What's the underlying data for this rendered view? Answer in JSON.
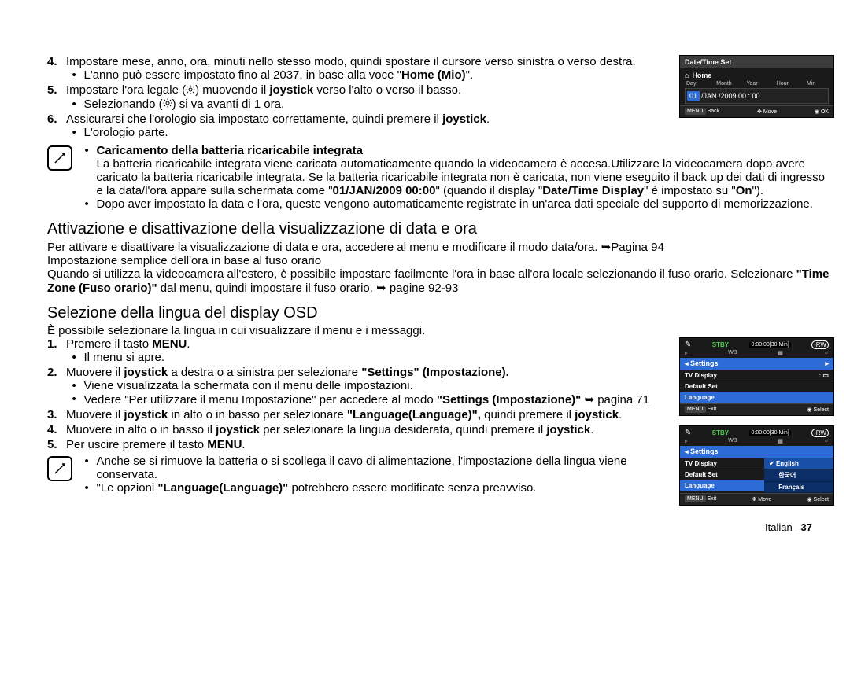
{
  "steps": {
    "s4": {
      "text": "Impostare mese, anno, ora, minuti nello stesso modo, quindi spostare il cursore verso sinistra o verso destra.",
      "sub": "L'anno può essere impostato fino al 2037, in base alla voce \"",
      "sub_bold": "Home (Mio)",
      "sub_end": "\"."
    },
    "s5": {
      "pre": "Impostare l'ora legale (",
      "mid": ") muovendo il ",
      "joystick": "joystick",
      "post": " verso l'alto o verso il basso.",
      "sub_pre": "Selezionando (",
      "sub_post": ") si va avanti di 1 ora."
    },
    "s6": {
      "text": "Assicurarsi che l'orologio sia impostato correttamente, quindi premere il ",
      "joystick": "joystick",
      "end": ".",
      "sub": "L'orologio parte."
    }
  },
  "note1": {
    "title": "Caricamento della batteria ricaricabile integrata",
    "body1": "La batteria ricaricabile integrata viene caricata automaticamente quando la videocamera è accesa.Utilizzare la videocamera dopo avere caricato la batteria ricaricabile integrata. Se la batteria ricaricabile integrata non è caricata, non viene eseguito il back up dei dati di ingresso e la data/l'ora appare sulla schermata come \"",
    "bold1": "01/JAN/2009 00:00",
    "body2": "\" (quando il display \"",
    "bold2": "Date/Time Display",
    "body3": "\" è impostato su \"",
    "bold3": "On",
    "body4": "\").",
    "bullet2": "Dopo aver impostato la data e l'ora, queste vengono automaticamente registrate in un'area dati speciale del supporto di memorizzazione."
  },
  "section1": {
    "heading": "Attivazione e disattivazione della visualizzazione di data e ora",
    "p1": "Per attivare e disattivare la visualizzazione di data e ora, accedere al menu e modificare il modo data/ora.  ➥Pagina 94",
    "p2": "Impostazione semplice dell'ora in base al fuso orario",
    "p3_pre": "Quando si utilizza la videocamera all'estero, è possibile impostare facilmente l'ora in base all'ora locale selezionando il fuso orario. Selezionare ",
    "p3_bold": "\"Time Zone (Fuso orario)\"",
    "p3_post": " dal menu, quindi impostare il fuso orario.  ➥ pagine 92-93"
  },
  "section2": {
    "heading": "Selezione della lingua del display OSD",
    "intro": "È possibile selezionare la lingua in cui visualizzare il menu e i messaggi.",
    "li1_pre": "Premere il tasto ",
    "li1_bold": "MENU",
    "li1_post": ".",
    "li1_sub": "Il menu si apre.",
    "li2_pre": "Muovere il ",
    "li2_joy": "joystick",
    "li2_mid": " a destra o a sinistra per selezionare ",
    "li2_bold": "\"Settings\" (Impostazione).",
    "li2_sub1": "Viene visualizzata la schermata con il menu delle impostazioni.",
    "li2_sub2_pre": "Vedere \"Per utilizzare il menu Impostazione\" per accedere al modo ",
    "li2_sub2_bold": "\"Settings (Impostazione)\"",
    "li2_sub2_post": "  ➥ pagina 71",
    "li3_pre": "Muovere il ",
    "li3_joy": "joystick",
    "li3_mid": " in alto o in basso per selezionare ",
    "li3_bold": "\"Language(Language)\",",
    "li3_post": " quindi premere il ",
    "li3_joy2": "joystick",
    "li3_end": ".",
    "li4_pre": "Muovere in alto o in basso il ",
    "li4_joy": "joystick",
    "li4_mid": " per selezionare la lingua desiderata, quindi premere il ",
    "li4_joy2": "joystick",
    "li5_pre": "Per uscire premere il tasto ",
    "li5_bold": "MENU"
  },
  "note2": {
    "b1": "Anche se si rimuove la batteria o si scollega il cavo di alimentazione, l'impostazione della lingua viene conservata.",
    "b2_pre": "\"Le opzioni ",
    "b2_bold": "\"Language(Language)\"",
    "b2_post": " potrebbero essere modificate senza preavviso."
  },
  "lcd1": {
    "title": "Date/Time Set",
    "home": "Home",
    "labels": [
      "Day",
      "Month",
      "Year",
      "Hour",
      "Min"
    ],
    "day": "01",
    "rest": " /JAN /2009  00 : 00",
    "foot": {
      "back": "Back",
      "move": "Move",
      "ok": "OK",
      "menu": "MENU"
    }
  },
  "lcd2": {
    "stby": "STBY",
    "time": "0:00:00[30 Min]",
    "rw": "-RW",
    "menu_title": "Settings",
    "items": [
      "TV Display",
      "Default Set",
      "Language"
    ],
    "foot": {
      "exit": "Exit",
      "select": "Select",
      "menu": "MENU"
    }
  },
  "lcd3": {
    "stby": "STBY",
    "time": "0:00:00[30 Min]",
    "rw": "-RW",
    "menu_title": "Settings",
    "items": [
      "TV Display",
      "Default Set",
      "Language"
    ],
    "options": [
      "English",
      "한국어",
      "Français"
    ],
    "foot": {
      "exit": "Exit",
      "move": "Move",
      "select": "Select",
      "menu": "MENU"
    }
  },
  "footer": {
    "lang": "Italian ",
    "page": "_37"
  }
}
